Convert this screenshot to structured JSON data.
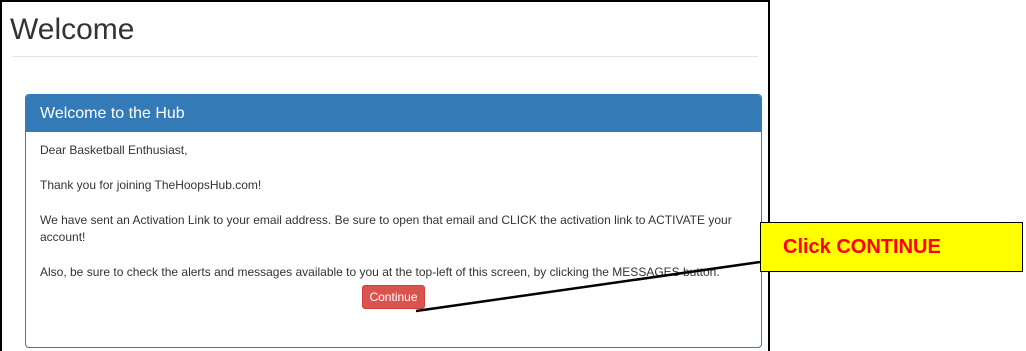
{
  "page": {
    "title": "Welcome"
  },
  "panel": {
    "heading": "Welcome to the Hub",
    "greeting": "Dear Basketball Enthusiast,",
    "thanks": "Thank you for joining TheHoopsHub.com!",
    "activation": "We have sent an Activation Link to your email address. Be sure to open that email and CLICK the activation link to ACTIVATE your account!",
    "alerts": "Also, be sure to check the alerts and messages available to you at the top-left of this screen, by clicking the MESSAGES button.",
    "continue_label": "Continue"
  },
  "callout": {
    "text": "Click CONTINUE"
  },
  "colors": {
    "panel_header": "#337ab7",
    "button_danger": "#d9534f",
    "callout_bg": "#ffff00",
    "callout_text": "#ff0000"
  }
}
